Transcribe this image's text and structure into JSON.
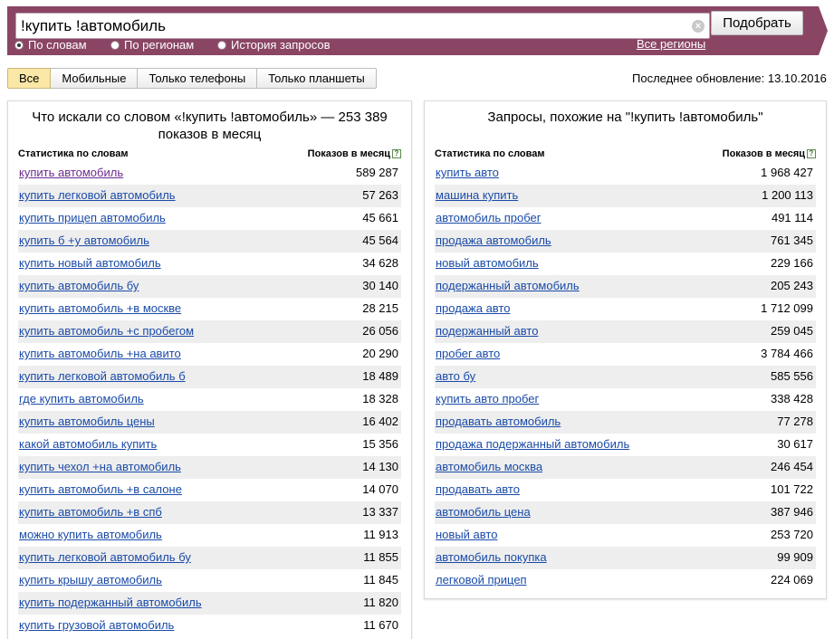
{
  "search": {
    "query": "!купить !автомобиль",
    "button_label": "Подобрать",
    "modes": [
      {
        "label": "По словам",
        "checked": true
      },
      {
        "label": "По регионам",
        "checked": false
      },
      {
        "label": "История запросов",
        "checked": false
      }
    ],
    "all_regions_label": "Все регионы"
  },
  "tabs": [
    {
      "label": "Все",
      "active": true
    },
    {
      "label": "Мобильные",
      "active": false
    },
    {
      "label": "Только телефоны",
      "active": false
    },
    {
      "label": "Только планшеты",
      "active": false
    }
  ],
  "last_update": "Последнее обновление: 13.10.2016",
  "left_panel": {
    "title": "Что искали со словом «!купить !автомобиль» — 253 389 показов в месяц",
    "col_words": "Статистика по словам",
    "col_shows": "Показов в месяц",
    "rows": [
      {
        "phrase": "купить автомобиль",
        "count": "589 287"
      },
      {
        "phrase": "купить легковой автомобиль",
        "count": "57 263"
      },
      {
        "phrase": "купить прицеп автомобиль",
        "count": "45 661"
      },
      {
        "phrase": "купить б +у автомобиль",
        "count": "45 564"
      },
      {
        "phrase": "купить новый автомобиль",
        "count": "34 628"
      },
      {
        "phrase": "купить автомобиль бу",
        "count": "30 140"
      },
      {
        "phrase": "купить автомобиль +в москве",
        "count": "28 215"
      },
      {
        "phrase": "купить автомобиль +с пробегом",
        "count": "26 056"
      },
      {
        "phrase": "купить автомобиль +на авито",
        "count": "20 290"
      },
      {
        "phrase": "купить легковой автомобиль б",
        "count": "18 489"
      },
      {
        "phrase": "где купить автомобиль",
        "count": "18 328"
      },
      {
        "phrase": "купить автомобиль цены",
        "count": "16 402"
      },
      {
        "phrase": "какой автомобиль купить",
        "count": "15 356"
      },
      {
        "phrase": "купить чехол +на автомобиль",
        "count": "14 130"
      },
      {
        "phrase": "купить автомобиль +в салоне",
        "count": "14 070"
      },
      {
        "phrase": "купить автомобиль +в спб",
        "count": "13 337"
      },
      {
        "phrase": "можно купить автомобиль",
        "count": "11 913"
      },
      {
        "phrase": "купить легковой автомобиль бу",
        "count": "11 855"
      },
      {
        "phrase": "купить крышу автомобиль",
        "count": "11 845"
      },
      {
        "phrase": "купить подержанный автомобиль",
        "count": "11 820"
      },
      {
        "phrase": "купить грузовой автомобиль",
        "count": "11 670"
      }
    ]
  },
  "right_panel": {
    "title": "Запросы, похожие на \"!купить !автомобиль\"",
    "col_words": "Статистика по словам",
    "col_shows": "Показов в месяц",
    "rows": [
      {
        "phrase": "купить авто",
        "count": "1 968 427"
      },
      {
        "phrase": "машина купить",
        "count": "1 200 113"
      },
      {
        "phrase": "автомобиль пробег",
        "count": "491 114"
      },
      {
        "phrase": "продажа автомобиль",
        "count": "761 345"
      },
      {
        "phrase": "новый автомобиль",
        "count": "229 166"
      },
      {
        "phrase": "подержанный автомобиль",
        "count": "205 243"
      },
      {
        "phrase": "продажа авто",
        "count": "1 712 099"
      },
      {
        "phrase": "подержанный авто",
        "count": "259 045"
      },
      {
        "phrase": "пробег авто",
        "count": "3 784 466"
      },
      {
        "phrase": "авто бу",
        "count": "585 556"
      },
      {
        "phrase": "купить авто пробег",
        "count": "338 428"
      },
      {
        "phrase": "продавать автомобиль",
        "count": "77 278"
      },
      {
        "phrase": "продажа подержанный автомобиль",
        "count": "30 617"
      },
      {
        "phrase": "автомобиль москва",
        "count": "246 454"
      },
      {
        "phrase": "продавать авто",
        "count": "101 722"
      },
      {
        "phrase": "автомобиль цена",
        "count": "387 946"
      },
      {
        "phrase": "новый авто",
        "count": "253 720"
      },
      {
        "phrase": "автомобиль покупка",
        "count": "99 909"
      },
      {
        "phrase": "легковой прицеп",
        "count": "224 069"
      }
    ]
  }
}
